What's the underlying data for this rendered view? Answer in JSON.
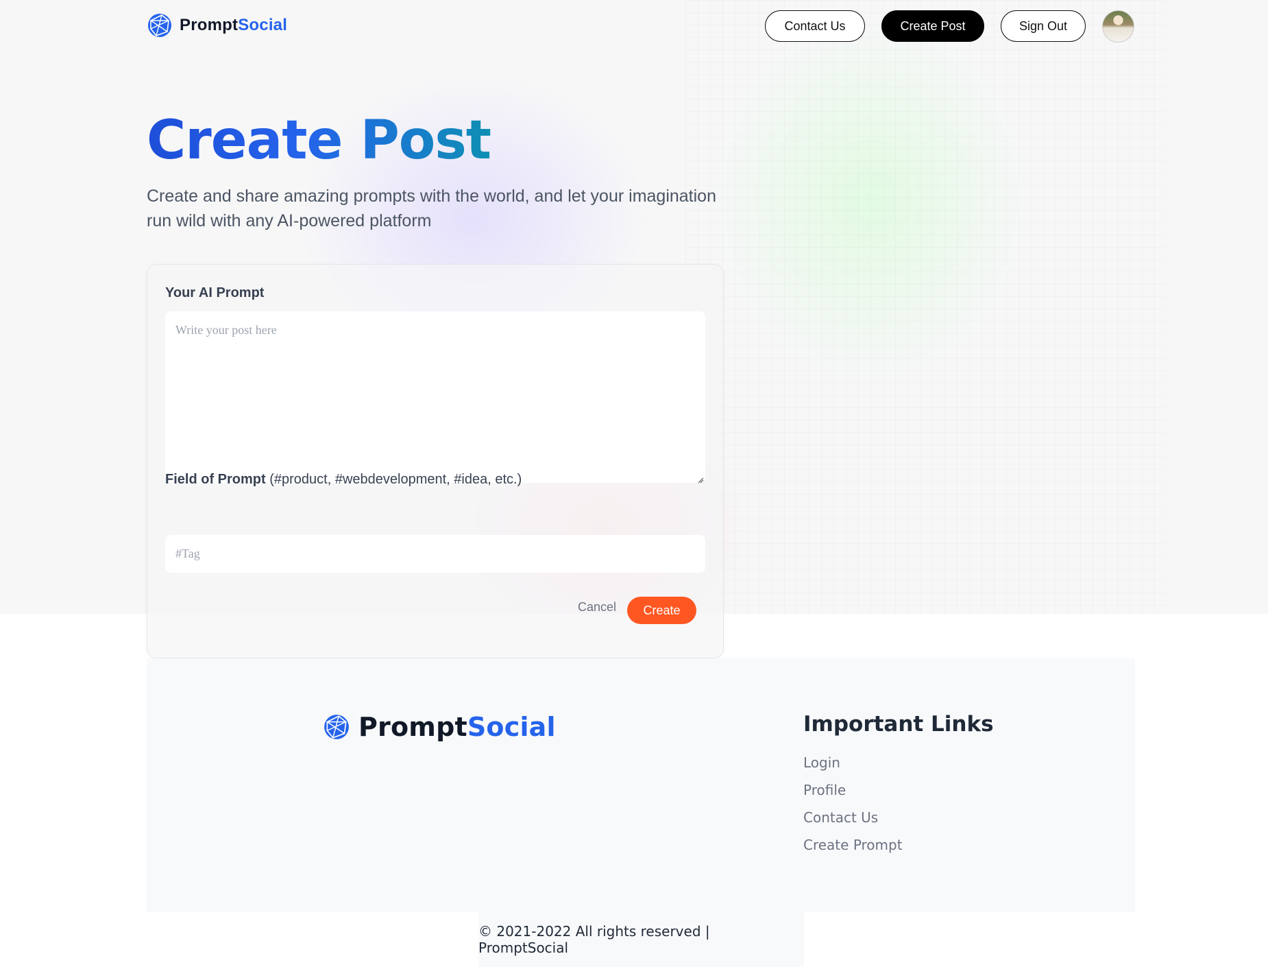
{
  "brand": {
    "name_part1": "Prompt",
    "name_part2": "Social",
    "accent_color": "#2563eb"
  },
  "nav": {
    "contact_label": "Contact Us",
    "create_post_label": "Create Post",
    "sign_out_label": "Sign Out",
    "avatar_icon": "user-avatar"
  },
  "hero": {
    "title": "Create Post",
    "subtitle": "Create and share amazing prompts with the world, and let your imagination run wild with any AI-powered platform"
  },
  "form": {
    "prompt_label": "Your AI Prompt",
    "prompt_value": "",
    "prompt_placeholder": "Write your post here",
    "tag_label": "Field of Prompt",
    "tag_hint": "(#product, #webdevelopment, #idea, etc.)",
    "tag_value": "",
    "tag_placeholder": "#Tag",
    "cancel_label": "Cancel",
    "create_label": "Create",
    "create_color": "#ff5722"
  },
  "footer": {
    "links_title": "Important Links",
    "links": [
      "Login",
      "Profile",
      "Contact Us",
      "Create Prompt"
    ],
    "copyright": "© 2021-2022 All rights reserved | PromptSocial"
  }
}
